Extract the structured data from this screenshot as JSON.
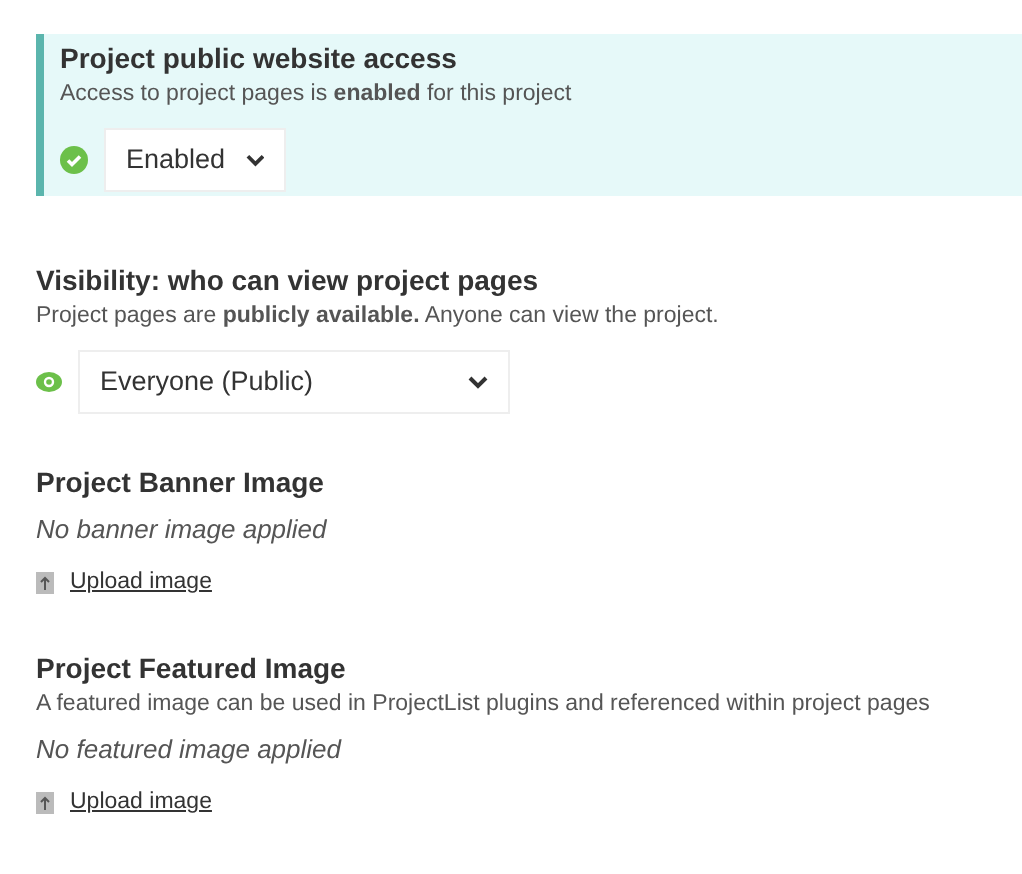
{
  "access": {
    "title": "Project public website access",
    "description": "Access to project pages is **enabled** for this project",
    "enabled": true,
    "value": "Enabled"
  },
  "visibility": {
    "title": "Visibility: who can view project pages",
    "description": "Project pages are **publicly available.** Anyone can view the project.",
    "value": "Everyone (Public)"
  },
  "images": [
    {
      "title": "Project Banner Image",
      "empty_text": "No banner image applied",
      "upload_link": "Upload image"
    },
    {
      "title": "Project Featured Image",
      "description": "A featured image can be used in ProjectList plugins and referenced within project pages",
      "empty_text": "No featured image applied",
      "upload_link": "Upload image"
    }
  ]
}
